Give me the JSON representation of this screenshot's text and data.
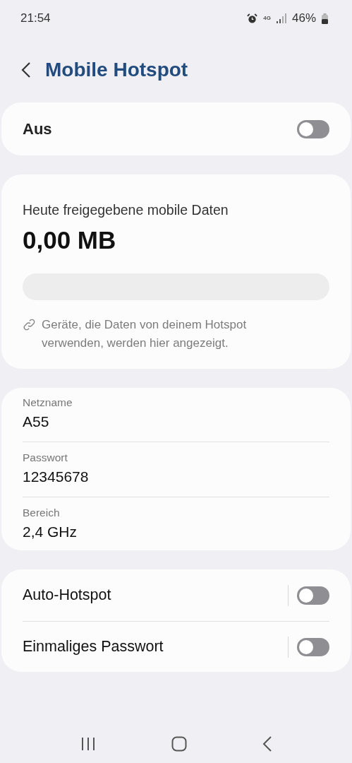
{
  "status_bar": {
    "time": "21:54",
    "network": "4G",
    "battery": "46%"
  },
  "header": {
    "title": "Mobile Hotspot"
  },
  "master_switch": {
    "label": "Aus",
    "on": false
  },
  "usage": {
    "label": "Heute freigegebene mobile Daten",
    "amount": "0,00 MB",
    "level": 0,
    "note": "Geräte, die Daten von deinem Hotspot verwenden, werden hier angezeigt."
  },
  "settings": [
    {
      "label": "Netzname",
      "value": "A55"
    },
    {
      "label": "Passwort",
      "value": "12345678"
    },
    {
      "label": "Bereich",
      "value": "2,4 GHz"
    }
  ],
  "options": [
    {
      "label": "Auto-Hotspot",
      "on": false
    },
    {
      "label": "Einmaliges Passwort",
      "on": false
    }
  ]
}
